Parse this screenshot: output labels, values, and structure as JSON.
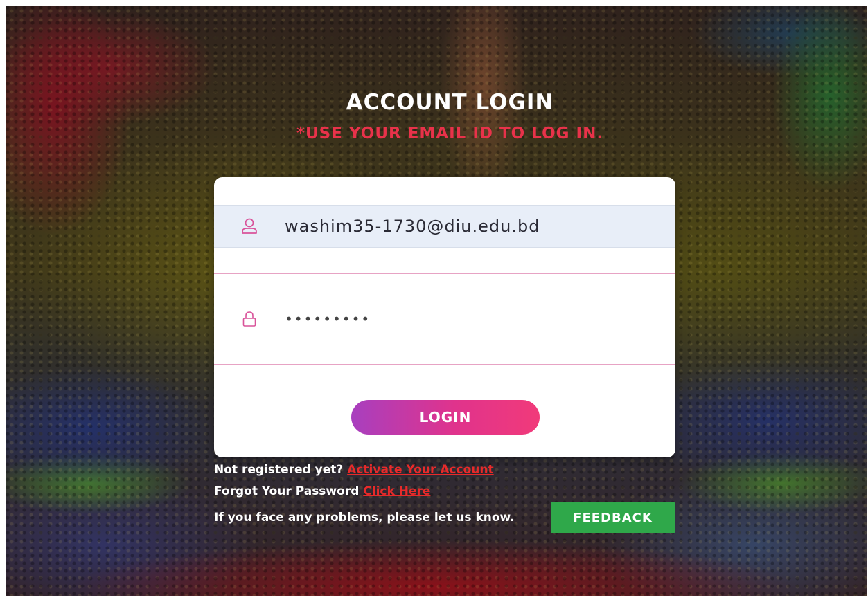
{
  "page": {
    "title": "ACCOUNT LOGIN",
    "subtitle": "*USE YOUR EMAIL ID TO LOG IN."
  },
  "form": {
    "email": {
      "value": "washim35-1730@diu.edu.bd",
      "icon": "user-icon"
    },
    "password": {
      "value": "•••••••••",
      "icon": "lock-icon"
    },
    "login_label": "LOGIN"
  },
  "links": {
    "not_registered_text": "Not registered yet?",
    "activate_link": "Activate Your Account",
    "forgot_text": "Forgot Your Password",
    "click_here_link": "Click Here",
    "problems_text": "If you face any problems, please let us know.",
    "feedback_label": "FEEDBACK"
  },
  "colors": {
    "accent_red": "#e8324a",
    "button_gradient_start": "#a83fbf",
    "button_gradient_end": "#f13a7a",
    "feedback_green": "#2fa84a",
    "input_border_pink": "#e7a3c4"
  }
}
